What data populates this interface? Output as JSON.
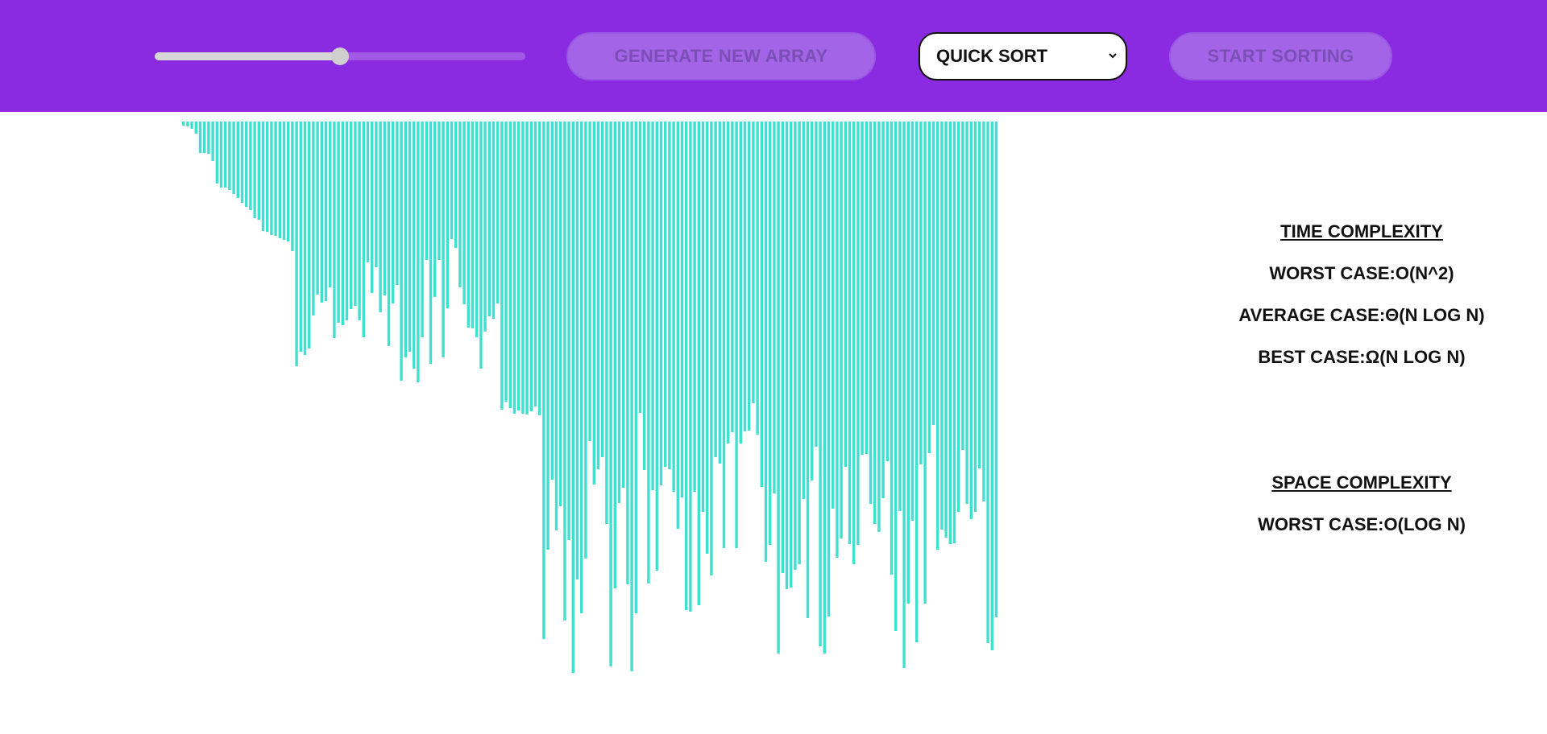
{
  "toolbar": {
    "array_size_slider": {
      "value_fraction": 0.5
    },
    "generate_label": "GENERATE NEW ARRAY",
    "algorithm_selected": "QUICK SORT",
    "start_label": "START SORTING"
  },
  "colors": {
    "header_bg": "#8a2be2",
    "bar": "#40e0d0",
    "button_disabled": "#a364e8"
  },
  "bars": {
    "heights": [
      5,
      6,
      9,
      15,
      39,
      39,
      40,
      49,
      77,
      82,
      82,
      85,
      90,
      95,
      101,
      106,
      110,
      120,
      122,
      136,
      137,
      141,
      142,
      145,
      147,
      149,
      161,
      304,
      286,
      290,
      282,
      241,
      215,
      225,
      223,
      206,
      269,
      250,
      253,
      247,
      233,
      229,
      247,
      268,
      175,
      213,
      181,
      237,
      216,
      279,
      226,
      203,
      322,
      293,
      286,
      307,
      324,
      268,
      172,
      301,
      218,
      172,
      293,
      232,
      146,
      157,
      206,
      227,
      256,
      257,
      268,
      307,
      261,
      242,
      245,
      226,
      358,
      348,
      356,
      363,
      359,
      363,
      364,
      360,
      354,
      365,
      643,
      532,
      445,
      508,
      478,
      620,
      520,
      685,
      569,
      611,
      543,
      397,
      451,
      432,
      417,
      500,
      677,
      580,
      474,
      455,
      575,
      683,
      611,
      362,
      433,
      574,
      458,
      558,
      452,
      429,
      432,
      460,
      506,
      467,
      607,
      609,
      460,
      601,
      485,
      537,
      564,
      417,
      425,
      530,
      400,
      386,
      530,
      400,
      385,
      384,
      350,
      389,
      454,
      547,
      526,
      462,
      661,
      561,
      581,
      579,
      557,
      550,
      469,
      617,
      446,
      404,
      652,
      661,
      615,
      481,
      542,
      518,
      429,
      525,
      550,
      526,
      414,
      413,
      475,
      500,
      510,
      468,
      422,
      563,
      633,
      484,
      679,
      599,
      496,
      647,
      426,
      599,
      412,
      377,
      532,
      507,
      517,
      525,
      524,
      485,
      408,
      475,
      494,
      485,
      431,
      472,
      648,
      657,
      616
    ],
    "max_value": 700
  },
  "complexity": {
    "time_title": "TIME COMPLEXITY",
    "worst": "WORST CASE:O(N^2)",
    "average": "AVERAGE CASE:Θ(N LOG N)",
    "best": "BEST CASE:Ω(N LOG N)",
    "space_title": "SPACE COMPLEXITY",
    "space_worst": "WORST CASE:O(LOG N)"
  }
}
